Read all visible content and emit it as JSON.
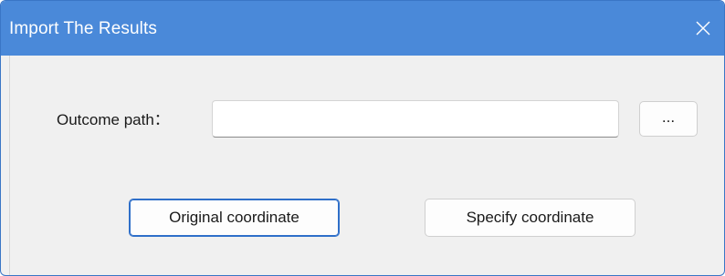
{
  "window": {
    "title": "Import The Results",
    "close_icon": "close-icon"
  },
  "form": {
    "outcome_path_label": "Outcome path：",
    "outcome_path_value": "",
    "browse_label": "..."
  },
  "buttons": {
    "original_label": "Original coordinate",
    "specify_label": "Specify coordinate"
  },
  "colors": {
    "titlebar": "#4a89d9",
    "focus_border": "#2f6fc9"
  }
}
